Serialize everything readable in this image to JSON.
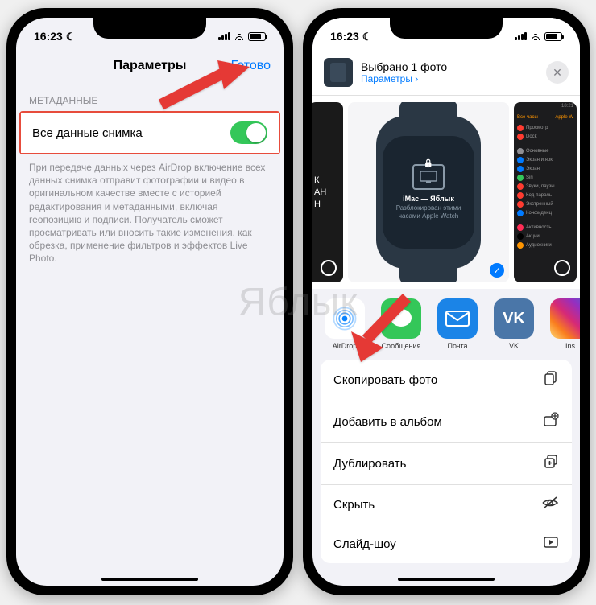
{
  "status": {
    "time": "16:23"
  },
  "left_screen": {
    "nav_title": "Параметры",
    "nav_done": "Готово",
    "section_label": "МЕТАДАННЫЕ",
    "toggle_label": "Все данные снимка",
    "description": "При передаче данных через AirDrop включение всех данных снимка отправит фотографии и видео в оригинальном качестве вместе с историей редактирования и метаданными, включая геопозицию и подписи. Получатель сможет просматривать или вносить такие изменения, как обрезка, применение фильтров и эффектов Live Photo."
  },
  "right_screen": {
    "share_title": "Выбрано 1 фото",
    "share_params": "Параметры ›",
    "watch_title": "iMac — Яблык",
    "watch_subtitle": "Разблокирован этими часами Apple Watch",
    "peek_text_lines": [
      "К",
      "АН",
      "Н"
    ],
    "right_peek_header_l": "Все часы",
    "right_peek_header_r": "Apple W",
    "right_peek_items": [
      "Просмотр",
      "Dock",
      "Основные",
      "Экран и ярк",
      "Экран",
      "Siri",
      "Звуки, паузы",
      "Код-пароль",
      "Экстренный",
      "Конфиденц"
    ],
    "right_peek_lower": [
      "Активность",
      "Акции",
      "Аудиокниги"
    ],
    "apps": [
      {
        "label": "AirDrop"
      },
      {
        "label": "Сообщения"
      },
      {
        "label": "Почта"
      },
      {
        "label": "VK"
      },
      {
        "label": "Ins"
      }
    ],
    "actions": [
      {
        "label": "Скопировать фото"
      },
      {
        "label": "Добавить в альбом"
      },
      {
        "label": "Дублировать"
      },
      {
        "label": "Скрыть"
      },
      {
        "label": "Слайд-шоу"
      }
    ]
  },
  "watermark": "Яблык"
}
